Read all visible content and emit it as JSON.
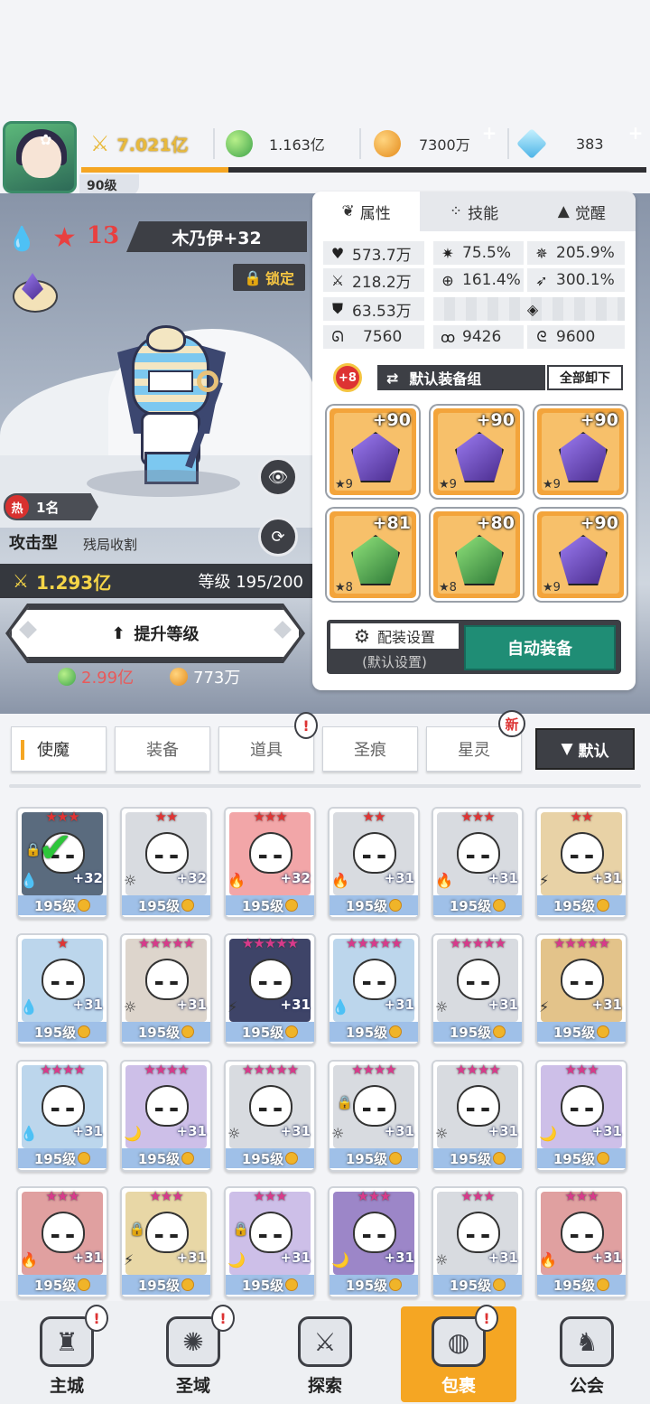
{
  "top": {
    "player_level": "90级",
    "power": "7.021亿",
    "gold": "1.163亿",
    "coins": "7300万",
    "gems": "383",
    "xp_progress": 0.26
  },
  "hero": {
    "element": "water",
    "stars": "13",
    "name": "木乃伊+32",
    "lock_label": "锁定",
    "rank_label": "热",
    "rank": "1名",
    "type": "攻击型",
    "role": "残局收割",
    "power": "1.293亿",
    "level": "等级 195/200",
    "upgrade_label": "提升等级",
    "cost_gold": "2.99亿",
    "cost_coin": "773万"
  },
  "panel": {
    "tabs": [
      {
        "label": "属性",
        "icon": "attribute-icon"
      },
      {
        "label": "技能",
        "icon": "skill-icon"
      },
      {
        "label": "觉醒",
        "icon": "awaken-icon"
      }
    ],
    "stats": {
      "hp": "573.7万",
      "crit": "75.5%",
      "crit_dmg": "205.9%",
      "atk": "218.2万",
      "accuracy": "161.4%",
      "speed": "300.1%",
      "def": "63.53万",
      "stat_a": "7560",
      "stat_b": "9426",
      "stat_c": "9600"
    },
    "set_bonus": "+8",
    "equip_set": "默认装备组",
    "unequip_all": "全部卸下",
    "equipment": [
      {
        "plus": "+90",
        "stars": "★9",
        "color": "purple"
      },
      {
        "plus": "+90",
        "stars": "★9",
        "color": "purple"
      },
      {
        "plus": "+90",
        "stars": "★9",
        "color": "purple"
      },
      {
        "plus": "+81",
        "stars": "★8",
        "color": "green"
      },
      {
        "plus": "+80",
        "stars": "★8",
        "color": "green"
      },
      {
        "plus": "+90",
        "stars": "★9",
        "color": "purple"
      }
    ],
    "config_label": "配装设置",
    "config_sub": "(默认设置)",
    "auto_equip": "自动装备"
  },
  "categories": [
    {
      "label": "使魔",
      "active": true
    },
    {
      "label": "装备"
    },
    {
      "label": "道具",
      "badge": "!"
    },
    {
      "label": "圣痕"
    },
    {
      "label": "星灵",
      "badge": "新"
    }
  ],
  "sort_label": "默认",
  "heroes": [
    {
      "stars": "★★★",
      "red": true,
      "plus": "+32",
      "level": "195级",
      "elem": "💧",
      "lock": true,
      "check": true,
      "bg": "#5a6b7e"
    },
    {
      "stars": "★★",
      "red": true,
      "plus": "+32",
      "level": "195级",
      "elem": "☼",
      "bg": "#d8dbe0"
    },
    {
      "stars": "★★★",
      "red": true,
      "plus": "+32",
      "level": "195级",
      "elem": "🔥",
      "bg": "#f2a6a8"
    },
    {
      "stars": "★★",
      "red": true,
      "plus": "+31",
      "level": "195级",
      "elem": "🔥",
      "bg": "#d8dbe0"
    },
    {
      "stars": "★★★",
      "red": true,
      "plus": "+31",
      "level": "195级",
      "elem": "🔥",
      "bg": "#d8dbe0"
    },
    {
      "stars": "★★",
      "red": true,
      "plus": "+31",
      "level": "195级",
      "elem": "⚡",
      "bg": "#e8d2a6"
    },
    {
      "stars": "★",
      "red": true,
      "plus": "+31",
      "level": "195级",
      "elem": "💧",
      "bg": "#bcd6ec"
    },
    {
      "stars": "★★★★★",
      "plus": "+31",
      "level": "195级",
      "elem": "☼",
      "bg": "#ddd5cc"
    },
    {
      "stars": "★★★★★",
      "plus": "+31",
      "level": "195级",
      "elem": "⚡",
      "bg": "#3e4468"
    },
    {
      "stars": "★★★★★",
      "plus": "+31",
      "level": "195级",
      "elem": "💧",
      "bg": "#bcd6ec"
    },
    {
      "stars": "★★★★★",
      "plus": "+31",
      "level": "195级",
      "elem": "☼",
      "bg": "#d8dbe0"
    },
    {
      "stars": "★★★★★",
      "plus": "+31",
      "level": "195级",
      "elem": "⚡",
      "bg": "#e3c38a"
    },
    {
      "stars": "★★★★",
      "plus": "+31",
      "level": "195级",
      "elem": "💧",
      "bg": "#bcd6ec"
    },
    {
      "stars": "★★★★",
      "plus": "+31",
      "level": "195级",
      "elem": "🌙",
      "bg": "#cdbfe8"
    },
    {
      "stars": "★★★★★",
      "plus": "+31",
      "level": "195级",
      "elem": "☼",
      "bg": "#d8dbe0"
    },
    {
      "stars": "★★★★",
      "plus": "+31",
      "level": "195级",
      "elem": "☼",
      "lock": true,
      "bg": "#d8dbe0"
    },
    {
      "stars": "★★★★",
      "plus": "+31",
      "level": "195级",
      "elem": "☼",
      "bg": "#d8dbe0"
    },
    {
      "stars": "★★★",
      "plus": "+31",
      "level": "195级",
      "elem": "🌙",
      "bg": "#cdbfe8"
    },
    {
      "stars": "★★★",
      "plus": "+31",
      "level": "195级",
      "elem": "🔥",
      "bg": "#e0a0a0"
    },
    {
      "stars": "★★★",
      "plus": "+31",
      "level": "195级",
      "elem": "⚡",
      "lock": true,
      "bg": "#e8d7a6"
    },
    {
      "stars": "★★★",
      "plus": "+31",
      "level": "195级",
      "elem": "🌙",
      "lock": true,
      "bg": "#cdbfe8"
    },
    {
      "stars": "★★★",
      "plus": "+31",
      "level": "195级",
      "elem": "🌙",
      "bg": "#9c86c8"
    },
    {
      "stars": "★★★",
      "plus": "+31",
      "level": "195级",
      "elem": "☼",
      "bg": "#d8dbe0"
    },
    {
      "stars": "★★★",
      "plus": "+31",
      "level": "195级",
      "elem": "🔥",
      "bg": "#e0a0a0"
    }
  ],
  "nav": [
    {
      "label": "主城",
      "icon": "castle-icon",
      "badge": "!"
    },
    {
      "label": "圣域",
      "icon": "portal-icon",
      "badge": "!"
    },
    {
      "label": "探索",
      "icon": "sword-icon"
    },
    {
      "label": "包裹",
      "icon": "bag-icon",
      "badge": "!",
      "active": true
    },
    {
      "label": "公会",
      "icon": "guild-icon"
    }
  ]
}
